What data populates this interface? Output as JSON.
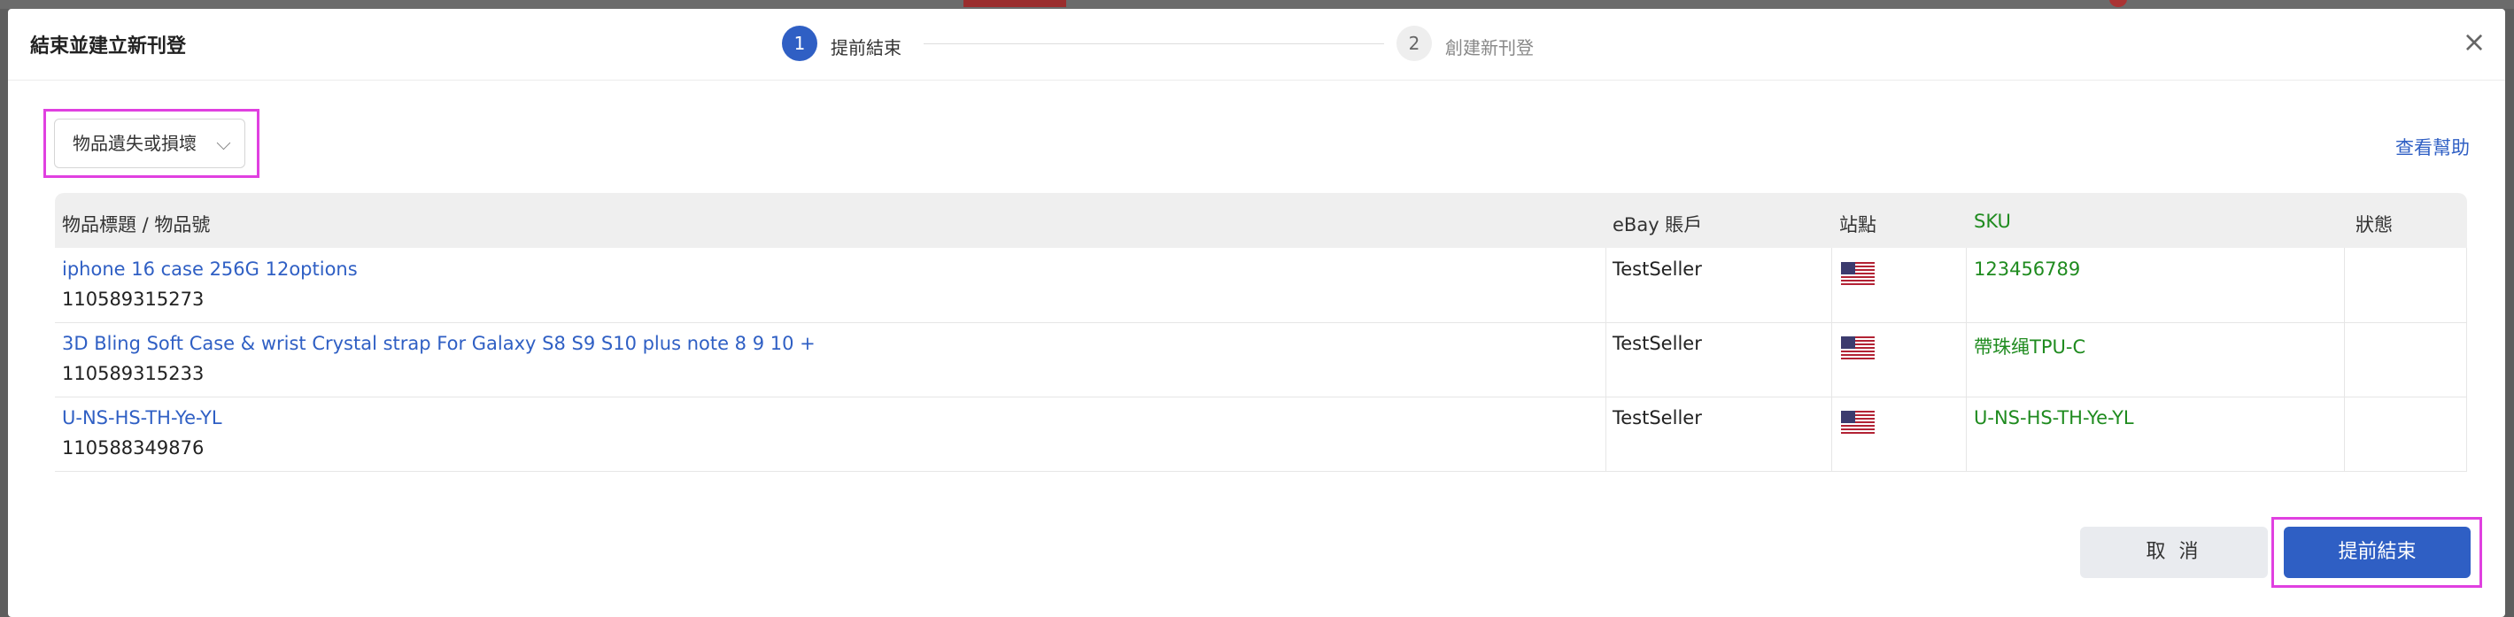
{
  "dialog": {
    "title": "結束並建立新刊登",
    "steps": [
      {
        "number": "1",
        "label": "提前結束"
      },
      {
        "number": "2",
        "label": "創建新刊登"
      }
    ]
  },
  "reason_select": {
    "value": "物品遺失或損壞"
  },
  "help_link": "查看幫助",
  "table": {
    "headers": {
      "title": "物品標題 / 物品號",
      "account": "eBay 賬戶",
      "site": "站點",
      "sku": "SKU",
      "status": "狀態"
    },
    "rows": [
      {
        "title": "iphone 16 case 256G 12options",
        "item_id": "110589315273",
        "account": "TestSeller",
        "site_icon": "us-flag-icon",
        "sku": "123456789",
        "status": ""
      },
      {
        "title": "3D Bling Soft Case & wrist Crystal strap For Galaxy S8 S9 S10 plus note 8 9 10 +",
        "item_id": "110589315233",
        "account": "TestSeller",
        "site_icon": "us-flag-icon",
        "sku": "帶珠绳TPU-C",
        "status": ""
      },
      {
        "title": "U-NS-HS-TH-Ye-YL",
        "item_id": "110588349876",
        "account": "TestSeller",
        "site_icon": "us-flag-icon",
        "sku": "U-NS-HS-TH-Ye-YL",
        "status": ""
      }
    ]
  },
  "buttons": {
    "cancel": "取 消",
    "submit": "提前結束"
  },
  "colors": {
    "primary": "#2f5fc4",
    "sku_green": "#1f8b1f",
    "highlight": "#e040e0"
  }
}
